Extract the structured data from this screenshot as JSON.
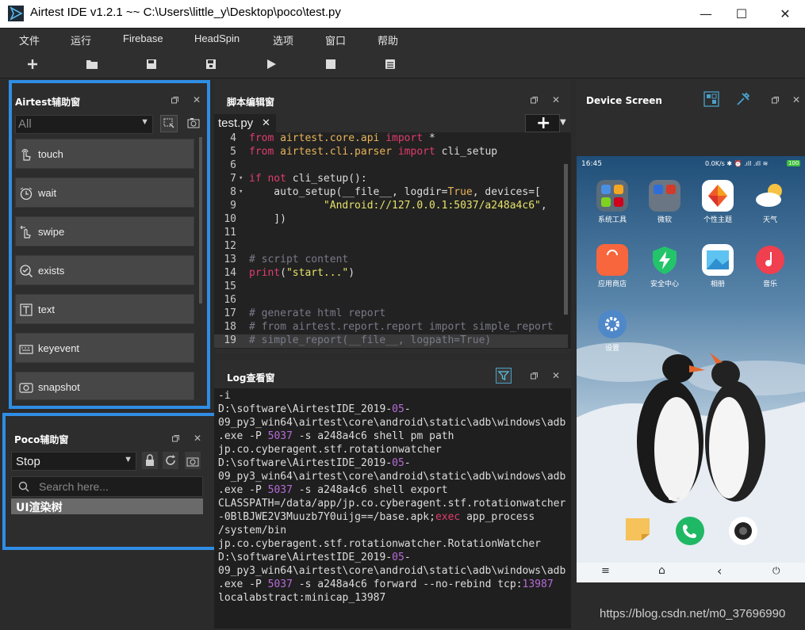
{
  "window": {
    "title": "Airtest IDE v1.2.1 ~~ C:\\Users\\little_y\\Desktop\\poco\\test.py",
    "minimize": "—",
    "maximize": "☐",
    "close": "✕"
  },
  "menu": [
    "文件",
    "运行",
    "Firebase",
    "HeadSpin",
    "选项",
    "窗口",
    "帮助"
  ],
  "toolbar": {
    "icons": [
      "new-file-icon",
      "open-folder-icon",
      "save-icon",
      "save-as-icon",
      "play-icon",
      "stop-icon",
      "report-icon"
    ]
  },
  "airtest_panel": {
    "title": "Airtest辅助窗",
    "filter_value": "All",
    "actions": [
      "touch",
      "wait",
      "swipe",
      "exists",
      "text",
      "keyevent",
      "snapshot"
    ]
  },
  "poco_panel": {
    "title": "Poco辅助窗",
    "mode_value": "Stop",
    "search_placeholder": "Search here...",
    "tree_root": "UI渲染树"
  },
  "editor": {
    "title": "脚本编辑窗",
    "tab_label": "test.py",
    "tab_close": "✕",
    "add_label": "+"
  },
  "code_lines": [
    {
      "num": "4",
      "fold": "",
      "text": "from airtest.core.api import *"
    },
    {
      "num": "5",
      "fold": "",
      "text": "from airtest.cli.parser import cli_setup"
    },
    {
      "num": "6",
      "fold": "",
      "text": ""
    },
    {
      "num": "7",
      "fold": "▾",
      "text": "if not cli_setup():"
    },
    {
      "num": "8",
      "fold": "▾",
      "text": "    auto_setup(__file__, logdir=True, devices=["
    },
    {
      "num": "9",
      "fold": "",
      "text": "            \"Android://127.0.0.1:5037/a248a4c6\","
    },
    {
      "num": "10",
      "fold": "",
      "text": "    ])"
    },
    {
      "num": "11",
      "fold": "",
      "text": ""
    },
    {
      "num": "12",
      "fold": "",
      "text": ""
    },
    {
      "num": "13",
      "fold": "",
      "text": "# script content"
    },
    {
      "num": "14",
      "fold": "",
      "text": "print(\"start...\")"
    },
    {
      "num": "15",
      "fold": "",
      "text": ""
    },
    {
      "num": "16",
      "fold": "",
      "text": ""
    },
    {
      "num": "17",
      "fold": "",
      "text": "# generate html report"
    },
    {
      "num": "18",
      "fold": "",
      "text": "# from airtest.report.report import simple_report"
    },
    {
      "num": "19",
      "fold": "",
      "text": "# simple_report(__file__, logpath=True)"
    }
  ],
  "log": {
    "title": "Log查看窗",
    "lines": [
      "-i",
      "D:\\software\\AirtestIDE_2019-05-",
      "09_py3_win64\\airtest\\core\\android\\static\\adb\\windows\\adb",
      ".exe -P 5037 -s a248a4c6 shell pm path",
      "jp.co.cyberagent.stf.rotationwatcher",
      "D:\\software\\AirtestIDE_2019-05-",
      "09_py3_win64\\airtest\\core\\android\\static\\adb\\windows\\adb",
      ".exe -P 5037 -s a248a4c6 shell export",
      "CLASSPATH=/data/app/jp.co.cyberagent.stf.rotationwatcher",
      "-0BlBJWE2V3Muuzb7Y0uijg==/base.apk;exec app_process",
      "/system/bin",
      "jp.co.cyberagent.stf.rotationwatcher.RotationWatcher",
      "D:\\software\\AirtestIDE_2019-05-",
      "09_py3_win64\\airtest\\core\\android\\static\\adb\\windows\\adb",
      ".exe -P 5037 -s a248a4c6 forward --no-rebind tcp:13987",
      "localabstract:minicap_13987"
    ]
  },
  "device_panel": {
    "title": "Device Screen",
    "status_time": "16:45",
    "status_right": "0.0K/s ✱ ⏰ .ıll .ıll ≋",
    "battery": "100",
    "apps": [
      "系统工具",
      "微软",
      "个性主题",
      "天气",
      "应用商店",
      "安全中心",
      "相册",
      "音乐",
      "设置"
    ],
    "nav": [
      "≡",
      "⌂",
      "‹",
      "⏻"
    ]
  },
  "watermark": "https://blog.csdn.net/m0_37696990",
  "colors": {
    "highlight_border": "#2f8de4",
    "keyword": "#e03c6e",
    "module": "#e8b45a",
    "string": "#e6e26a",
    "comment": "#7a7a8a",
    "number": "#c678dd",
    "log_number": "#b66bd6"
  }
}
